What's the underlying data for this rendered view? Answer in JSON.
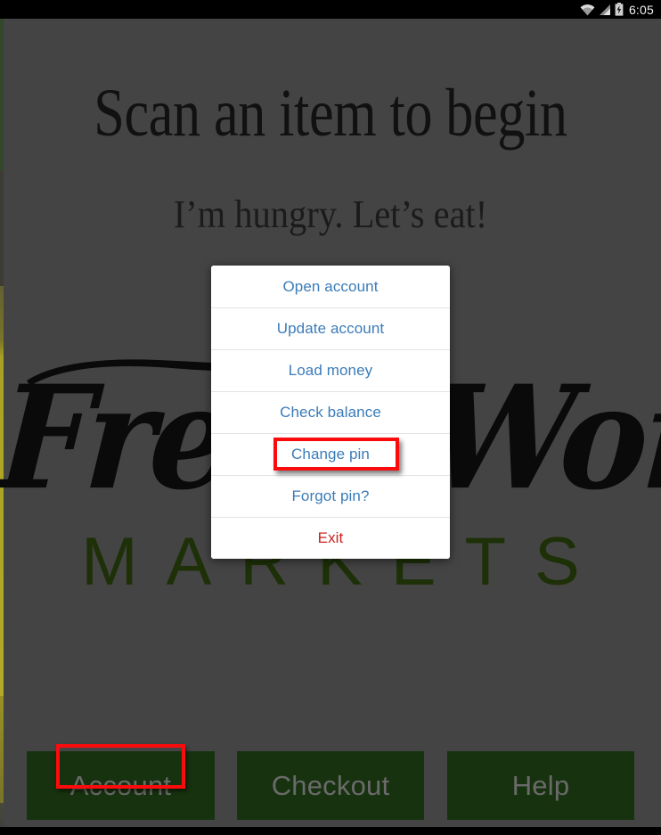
{
  "status_bar": {
    "time": "6:05",
    "icons": [
      "wifi-icon",
      "cellular-signal-icon",
      "battery-charging-icon"
    ]
  },
  "app": {
    "headline": "Scan an item to begin",
    "subheadline": "I’m hungry. Let’s eat!",
    "logo": {
      "script_text": "Fresh Work",
      "markets_text": "MARKETS"
    }
  },
  "bottom_buttons": [
    {
      "label": "Account",
      "name": "account-button"
    },
    {
      "label": "Checkout",
      "name": "checkout-button"
    },
    {
      "label": "Help",
      "name": "help-button"
    }
  ],
  "dialog": {
    "items": [
      {
        "label": "Open account",
        "style": "link"
      },
      {
        "label": "Update account",
        "style": "link"
      },
      {
        "label": "Load money",
        "style": "link"
      },
      {
        "label": "Check balance",
        "style": "link"
      },
      {
        "label": "Change pin",
        "style": "link"
      },
      {
        "label": "Forgot pin?",
        "style": "link"
      },
      {
        "label": "Exit",
        "style": "danger"
      }
    ]
  },
  "annotations": {
    "highlight_color": "#fb0b0b",
    "highlighted_targets": [
      "Change pin",
      "Account"
    ]
  },
  "colors": {
    "dim_overlay": "#444444",
    "dialog_bg": "#ffffff",
    "link_blue": "#3b7cb8",
    "danger_red": "#cc1f1f",
    "button_green": "#17320f",
    "markets_green": "#1d3007",
    "status_bar_black": "#000000"
  }
}
